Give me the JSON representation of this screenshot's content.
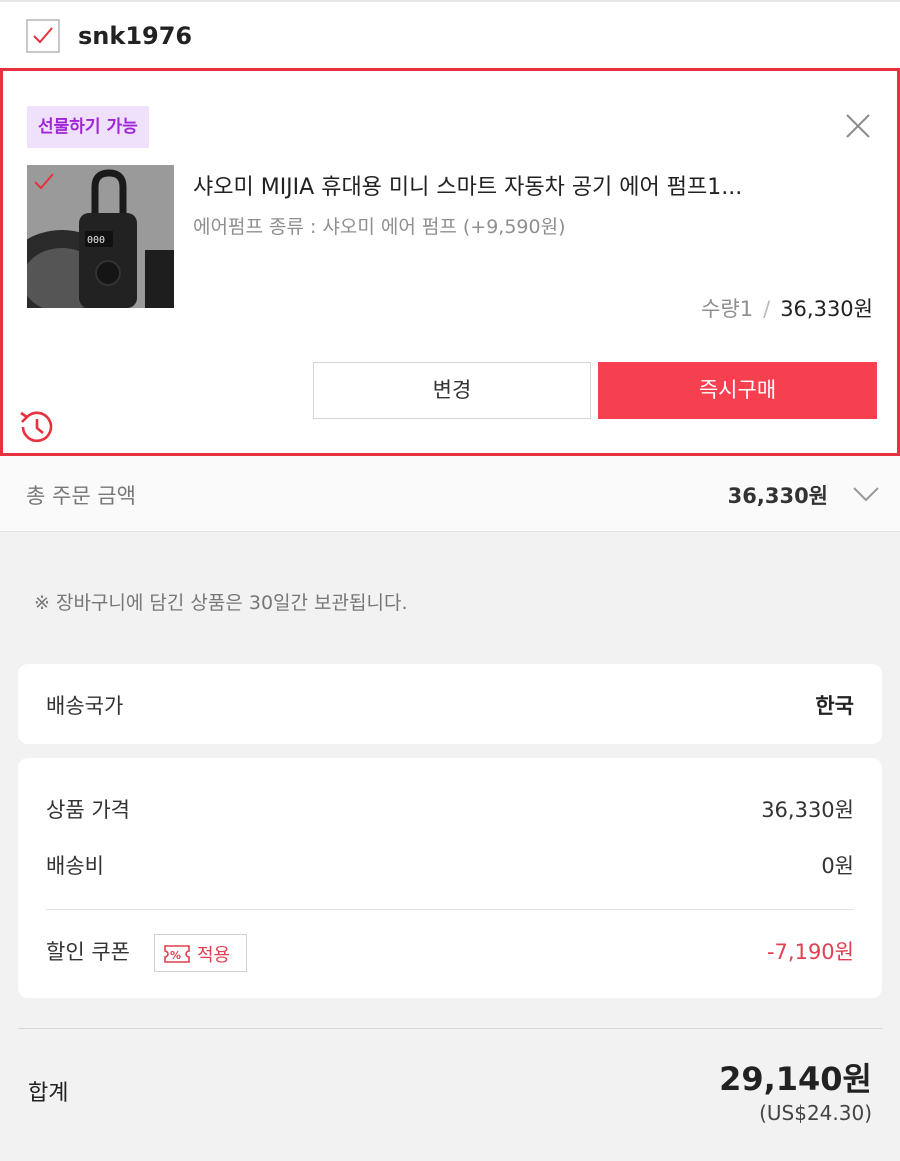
{
  "seller": {
    "name": "snk1976",
    "checked": true
  },
  "item": {
    "gift_badge": "선물하기 가능",
    "title": "샤오미 MIJIA 휴대용 미니 스마트 자동차 공기 에어 펌프1...",
    "option": "에어펌프 종류 : 샤오미 에어 펌프 (+9,590원)",
    "quantity": "수량1",
    "separator": "/",
    "price": "36,330원",
    "change_label": "변경",
    "buy_now_label": "즉시구매"
  },
  "total_order": {
    "label": "총 주문 금액",
    "value": "36,330원"
  },
  "notice": "※ 장바구니에 담긴 상품은 30일간 보관됩니다.",
  "shipping_country": {
    "label": "배송국가",
    "value": "한국"
  },
  "price_breakdown": {
    "product_price_label": "상품 가격",
    "product_price_value": "36,330원",
    "shipping_label": "배송비",
    "shipping_value": "0원",
    "coupon_label": "할인 쿠폰",
    "coupon_button": "적용",
    "coupon_value": "-7,190원"
  },
  "summary": {
    "label": "합계",
    "value": "29,140원",
    "usd": "(US$24.30)"
  },
  "colors": {
    "accent_red": "#e8313f",
    "buy_button": "#f6404f",
    "gift_purple": "#a026d8",
    "gift_bg": "#efe0fb"
  }
}
